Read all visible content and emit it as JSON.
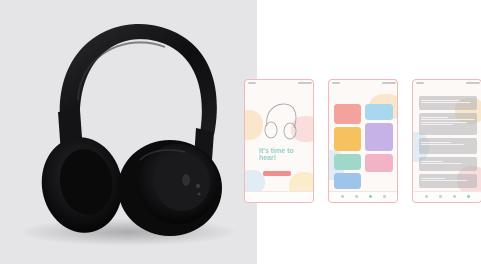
{
  "product_photo": {
    "alt": "Black over-ear wireless headphones",
    "background": "#e5e5e7",
    "headphone_color": "#101012"
  },
  "mockups": {
    "accent": "#f18f8f",
    "teal": "#8fcfc7",
    "screens": [
      {
        "hero_text": "It's time to hear!"
      }
    ]
  }
}
